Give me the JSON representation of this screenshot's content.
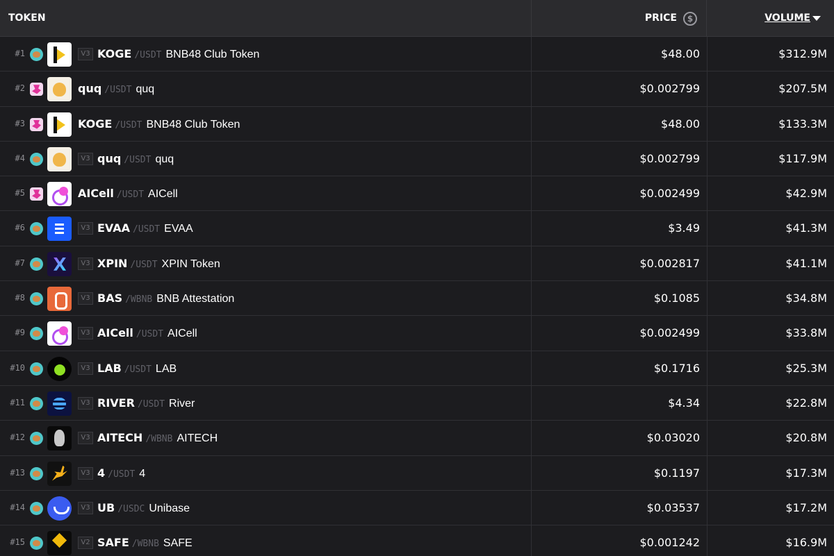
{
  "header": {
    "token_label": "TOKEN",
    "price_label": "PRICE",
    "volume_label": "VOLUME",
    "price_icon": "dollar-circle-icon",
    "volume_sort_icon": "caret-down-icon"
  },
  "rows": [
    {
      "rank": "#1",
      "dex": "pancake",
      "version": "V3",
      "symbol": "KOGE",
      "pair": "/USDT",
      "name": "BNB48 Club Token",
      "logo": "koge",
      "price": "$48.00",
      "volume": "$312.9M"
    },
    {
      "rank": "#2",
      "dex": "uniswap",
      "version": "",
      "symbol": "quq",
      "pair": "/USDT",
      "name": "quq",
      "logo": "quq",
      "price": "$0.002799",
      "volume": "$207.5M"
    },
    {
      "rank": "#3",
      "dex": "uniswap",
      "version": "",
      "symbol": "KOGE",
      "pair": "/USDT",
      "name": "BNB48 Club Token",
      "logo": "koge",
      "price": "$48.00",
      "volume": "$133.3M"
    },
    {
      "rank": "#4",
      "dex": "pancake",
      "version": "V3",
      "symbol": "quq",
      "pair": "/USDT",
      "name": "quq",
      "logo": "quq",
      "price": "$0.002799",
      "volume": "$117.9M"
    },
    {
      "rank": "#5",
      "dex": "uniswap",
      "version": "",
      "symbol": "AICell",
      "pair": "/USDT",
      "name": "AICell",
      "logo": "aicell",
      "price": "$0.002499",
      "volume": "$42.9M"
    },
    {
      "rank": "#6",
      "dex": "pancake",
      "version": "V3",
      "symbol": "EVAA",
      "pair": "/USDT",
      "name": "EVAA",
      "logo": "evaa",
      "price": "$3.49",
      "volume": "$41.3M"
    },
    {
      "rank": "#7",
      "dex": "pancake",
      "version": "V3",
      "symbol": "XPIN",
      "pair": "/USDT",
      "name": "XPIN Token",
      "logo": "xpin",
      "price": "$0.002817",
      "volume": "$41.1M"
    },
    {
      "rank": "#8",
      "dex": "pancake",
      "version": "V3",
      "symbol": "BAS",
      "pair": "/WBNB",
      "name": "BNB Attestation",
      "logo": "bas",
      "price": "$0.1085",
      "volume": "$34.8M"
    },
    {
      "rank": "#9",
      "dex": "pancake",
      "version": "V3",
      "symbol": "AICell",
      "pair": "/USDT",
      "name": "AICell",
      "logo": "aicell",
      "price": "$0.002499",
      "volume": "$33.8M"
    },
    {
      "rank": "#10",
      "dex": "pancake",
      "version": "V3",
      "symbol": "LAB",
      "pair": "/USDT",
      "name": "LAB",
      "logo": "lab",
      "price": "$0.1716",
      "volume": "$25.3M"
    },
    {
      "rank": "#11",
      "dex": "pancake",
      "version": "V3",
      "symbol": "RIVER",
      "pair": "/USDT",
      "name": "River",
      "logo": "river",
      "price": "$4.34",
      "volume": "$22.8M"
    },
    {
      "rank": "#12",
      "dex": "pancake",
      "version": "V3",
      "symbol": "AITECH",
      "pair": "/WBNB",
      "name": "AITECH",
      "logo": "aitech",
      "price": "$0.03020",
      "volume": "$20.8M"
    },
    {
      "rank": "#13",
      "dex": "pancake",
      "version": "V3",
      "symbol": "4",
      "pair": "/USDT",
      "name": "4",
      "logo": "four",
      "price": "$0.1197",
      "volume": "$17.3M"
    },
    {
      "rank": "#14",
      "dex": "pancake",
      "version": "V3",
      "symbol": "UB",
      "pair": "/USDC",
      "name": "Unibase",
      "logo": "ub",
      "price": "$0.03537",
      "volume": "$17.2M"
    },
    {
      "rank": "#15",
      "dex": "pancake",
      "version": "V2",
      "symbol": "SAFE",
      "pair": "/WBNB",
      "name": "SAFE",
      "logo": "safe",
      "price": "$0.001242",
      "volume": "$16.9M"
    }
  ]
}
